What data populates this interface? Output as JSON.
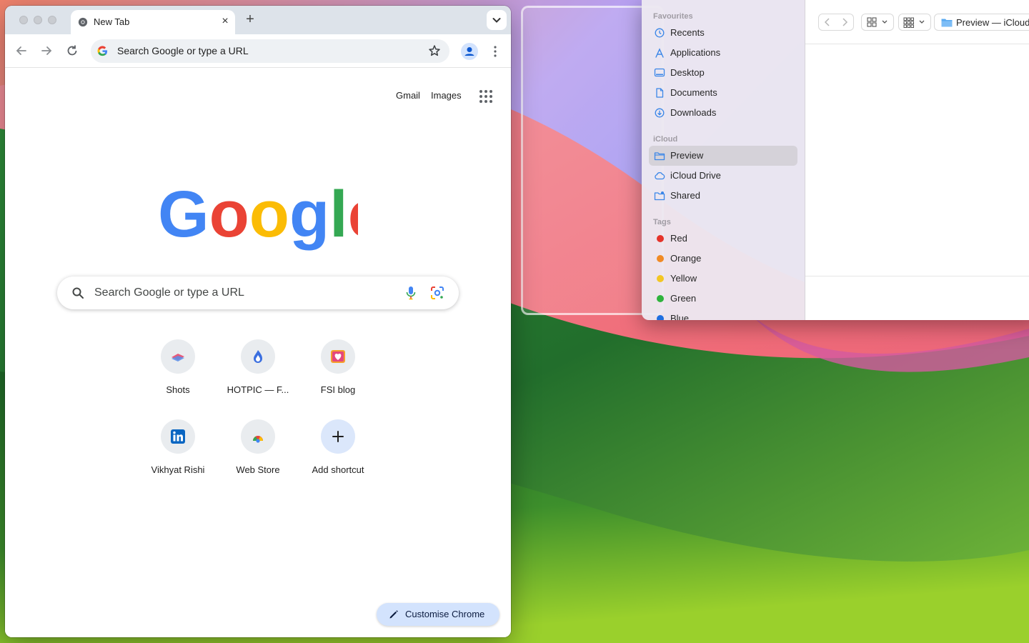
{
  "chrome": {
    "tab": {
      "title": "New Tab",
      "close_label": "×",
      "new_tab_label": "+"
    },
    "omnibox": {
      "placeholder": "Search Google or type a URL"
    },
    "ntp": {
      "top_links": {
        "gmail": "Gmail",
        "images": "Images"
      },
      "logo_letters": [
        "G",
        "o",
        "o",
        "g",
        "l",
        "e"
      ],
      "search_placeholder": "Search Google or type a URL",
      "shortcuts": [
        {
          "label": "Shots",
          "icon": "shots-icon"
        },
        {
          "label": "HOTPIC — F...",
          "icon": "hotpic-icon"
        },
        {
          "label": "FSI blog",
          "icon": "fsi-blog-icon"
        },
        {
          "label": "Vikhyat Rishi",
          "icon": "linkedin-icon"
        },
        {
          "label": "Web Store",
          "icon": "web-store-icon"
        },
        {
          "label": "Add shortcut",
          "icon": "plus-icon"
        }
      ],
      "customise_label": "Customise Chrome"
    }
  },
  "finder": {
    "sections": {
      "favourites": "Favourites",
      "icloud": "iCloud",
      "tags": "Tags"
    },
    "favourites": [
      {
        "label": "Recents",
        "icon": "clock-icon"
      },
      {
        "label": "Applications",
        "icon": "applications-icon"
      },
      {
        "label": "Desktop",
        "icon": "desktop-icon"
      },
      {
        "label": "Documents",
        "icon": "document-icon"
      },
      {
        "label": "Downloads",
        "icon": "download-icon"
      }
    ],
    "icloud": [
      {
        "label": "Preview",
        "icon": "folder-icon",
        "selected": true
      },
      {
        "label": "iCloud Drive",
        "icon": "cloud-icon"
      },
      {
        "label": "Shared",
        "icon": "shared-folder-icon"
      }
    ],
    "tags": [
      {
        "label": "Red",
        "color": "#e5332a"
      },
      {
        "label": "Orange",
        "color": "#f08a24"
      },
      {
        "label": "Yellow",
        "color": "#f3c623"
      },
      {
        "label": "Green",
        "color": "#2fb33d"
      },
      {
        "label": "Blue",
        "color": "#1f6fe0"
      }
    ],
    "path_title": "Preview — iCloud"
  },
  "colors": {
    "google_blue": "#4285F4",
    "google_red": "#EA4335",
    "google_yellow": "#FBBC05",
    "google_green": "#34A853",
    "selection_gray": "#d5d2d9",
    "finder_accent": "#3a86e8"
  }
}
